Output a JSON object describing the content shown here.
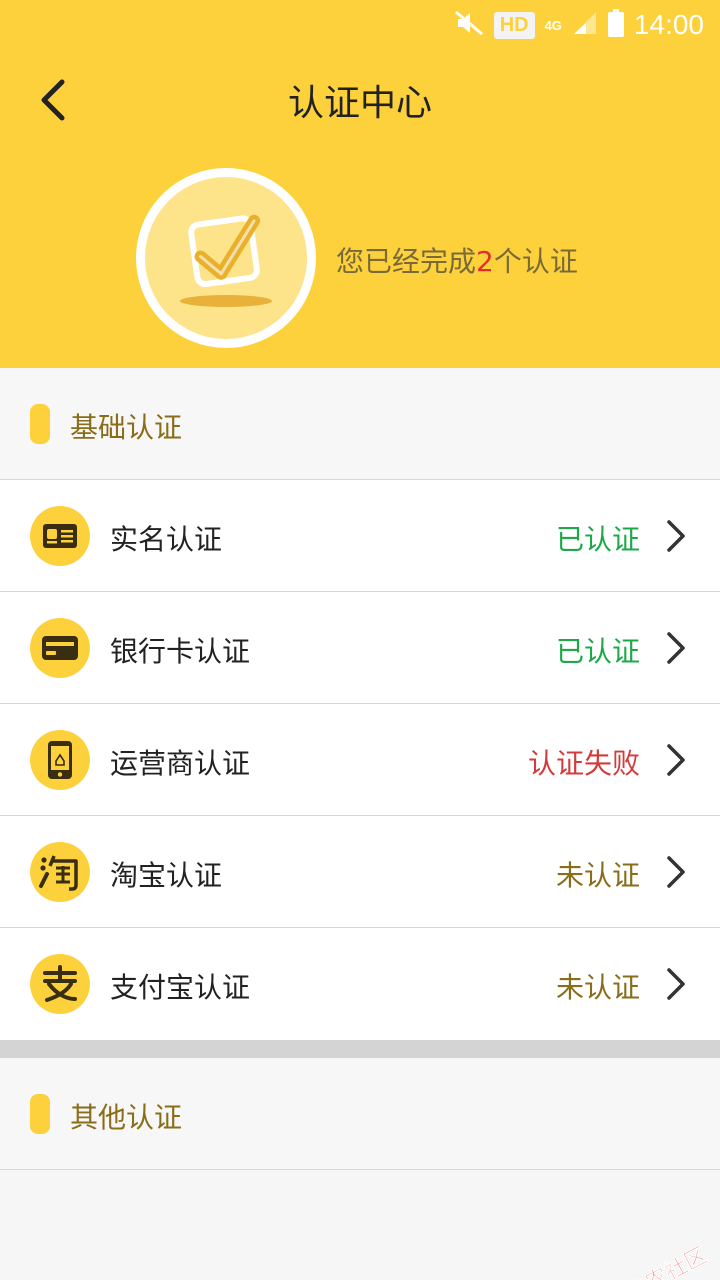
{
  "status_bar": {
    "network_badge": "HD",
    "network_type": "4G",
    "time": "14:00"
  },
  "header": {
    "title": "认证中心"
  },
  "summary": {
    "prefix": "您已经完成",
    "count": "2",
    "suffix": "个认证"
  },
  "sections": {
    "basic": {
      "title": "基础认证"
    },
    "other": {
      "title": "其他认证"
    }
  },
  "items": [
    {
      "label": "实名认证",
      "status": "已认证",
      "icon": "id-card-icon",
      "status_color": "#1fa84a"
    },
    {
      "label": "银行卡认证",
      "status": "已认证",
      "icon": "bank-card-icon",
      "status_color": "#1fa84a"
    },
    {
      "label": "运营商认证",
      "status": "认证失败",
      "icon": "phone-icon",
      "status_color": "#d33b3b"
    },
    {
      "label": "淘宝认证",
      "status": "未认证",
      "icon": "taobao-icon",
      "status_color": "#8a6d18"
    },
    {
      "label": "支付宝认证",
      "status": "未认证",
      "icon": "alipay-icon",
      "status_color": "#8a6d18"
    }
  ],
  "watermark": {
    "text": "卡农社区"
  },
  "colors": {
    "brand_yellow": "#fdd13b",
    "success": "#1fa84a",
    "fail": "#d33b3b",
    "pending": "#8a6d18"
  }
}
